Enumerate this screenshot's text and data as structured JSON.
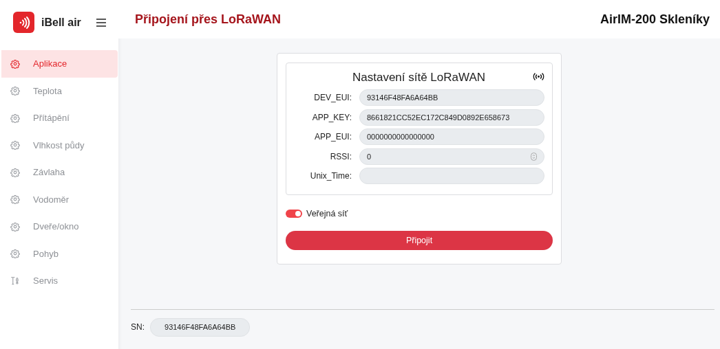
{
  "brand": {
    "name": "iBell air"
  },
  "page_title": "Připojení přes LoRaWAN",
  "device_title": "AirIM-200 Skleníky",
  "sidebar": {
    "items": [
      {
        "label": "Aplikace",
        "kind": "module",
        "selected": true
      },
      {
        "label": "Teplota",
        "kind": "module",
        "selected": false
      },
      {
        "label": "Přítápění",
        "kind": "module",
        "selected": false
      },
      {
        "label": "Vlhkost půdy",
        "kind": "module",
        "selected": false
      },
      {
        "label": "Závlaha",
        "kind": "module",
        "selected": false
      },
      {
        "label": "Vodoměr",
        "kind": "module",
        "selected": false
      },
      {
        "label": "Dveře/okno",
        "kind": "module",
        "selected": false
      },
      {
        "label": "Pohyb",
        "kind": "module",
        "selected": false
      },
      {
        "label": "Servis",
        "kind": "service",
        "selected": false
      }
    ]
  },
  "panel": {
    "title": "Nastavení sítě LoRaWAN",
    "fields": [
      {
        "label": "DEV_EUI:",
        "kind": "text",
        "value": "93146F48FA6A64BB"
      },
      {
        "label": "APP_KEY:",
        "kind": "text",
        "value": "8661821CC52EC172C849D0892E658673"
      },
      {
        "label": "APP_EUI:",
        "kind": "text",
        "value": "0000000000000000"
      },
      {
        "label": "RSSI:",
        "kind": "number",
        "value": "0"
      },
      {
        "label": "Unix_Time:",
        "kind": "text"
      }
    ]
  },
  "public_network": {
    "label": "Veřejná síť",
    "on": true
  },
  "connect_button": "Připojit",
  "footer": {
    "label": "SN:",
    "value": "93146F48FA6A64BB"
  }
}
